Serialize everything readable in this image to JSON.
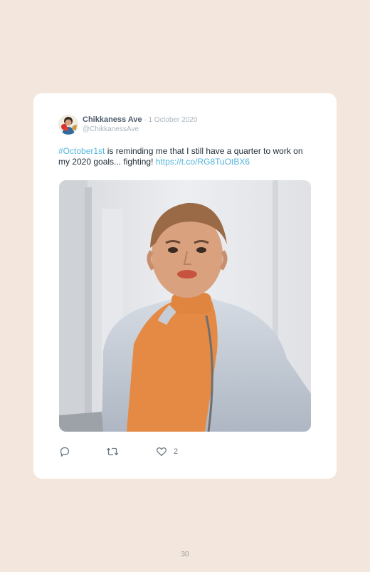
{
  "tweet": {
    "author_name": "Chikkaness Ave",
    "separator": " · ",
    "date": "1 October 2020",
    "handle": "@ChikkanessAve",
    "hashtag": "#October1st",
    "text_body": " is reminding me that I still have a quarter to work on my 2020 goals... fighting! ",
    "link": "https://t.co/RG8TuOtBX6",
    "like_count": "2"
  },
  "icons": {
    "reply": "reply-icon",
    "retweet": "retweet-icon",
    "like": "heart-icon"
  },
  "colors": {
    "page_background": "#f3e7dd",
    "card_background": "#ffffff",
    "link_color": "#52b5dd",
    "name_color": "#4a5a68",
    "meta_color": "#a9b5bf"
  },
  "footer": {
    "page_number": "30"
  }
}
